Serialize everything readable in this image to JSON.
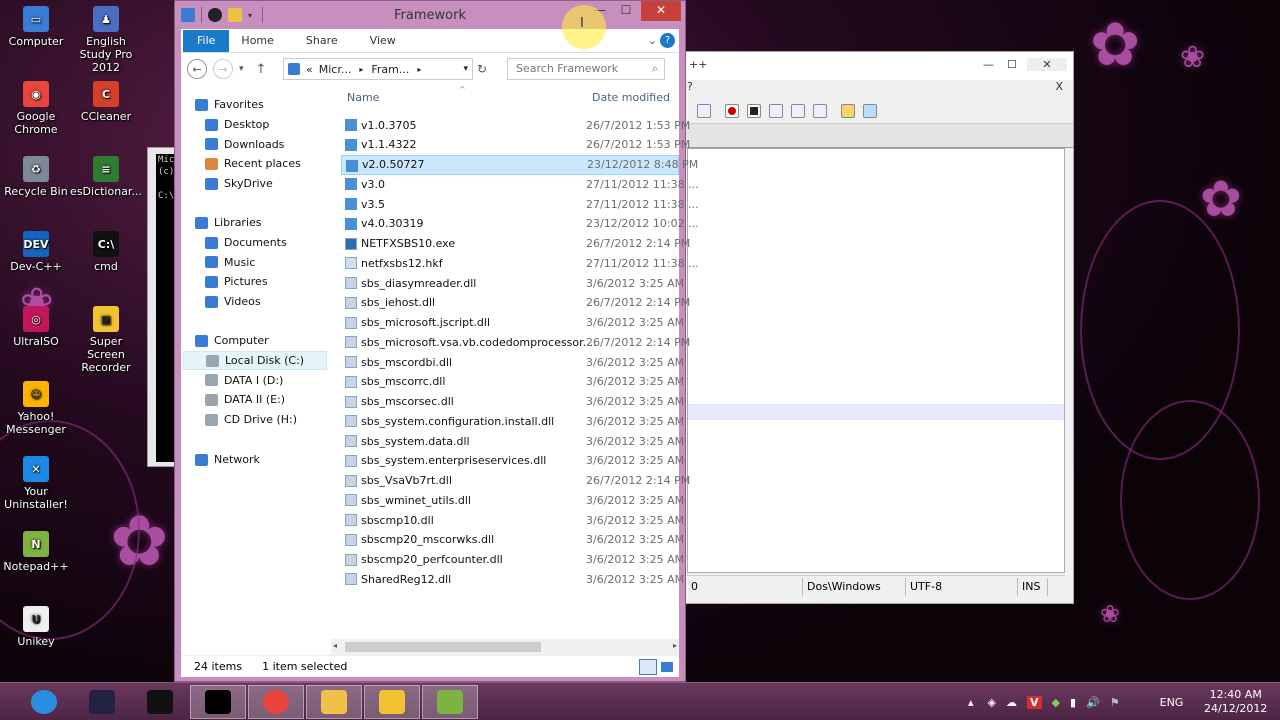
{
  "desktop": {
    "icons": [
      {
        "label": "Computer",
        "color": "#3a7bd5",
        "glyph": "▭"
      },
      {
        "label": "English Study Pro 2012",
        "color": "#4a6fc0",
        "glyph": "♟"
      },
      {
        "label": "Google Chrome",
        "color": "#e8453c",
        "glyph": "◉"
      },
      {
        "label": "CCleaner",
        "color": "#d6402b",
        "glyph": "C"
      },
      {
        "label": "Recycle Bin",
        "color": "#7d8a96",
        "glyph": "♻"
      },
      {
        "label": "esDictionar...",
        "color": "#2e7d32",
        "glyph": "≡"
      },
      {
        "label": "Dev-C++",
        "color": "#1565c0",
        "glyph": "DEV"
      },
      {
        "label": "cmd",
        "color": "#111111",
        "glyph": "C:\\"
      },
      {
        "label": "UltraISO",
        "color": "#c2185b",
        "glyph": "◎"
      },
      {
        "label": "Super Screen Recorder",
        "color": "#f2c230",
        "glyph": "▣"
      },
      {
        "label": "Yahoo! Messenger",
        "color": "#ffb300",
        "glyph": "☺"
      },
      {
        "label": "Your Uninstaller!",
        "color": "#1e88e5",
        "glyph": "✕"
      },
      {
        "label": "Notepad++",
        "color": "#7cb342",
        "glyph": "N"
      },
      {
        "label": "Unikey",
        "color": "#eeeeee",
        "glyph": "U"
      }
    ]
  },
  "cmd_window": {
    "lines": [
      "Mic",
      "(c)",
      "",
      "C:\\"
    ]
  },
  "notepadpp": {
    "title_fragment": "++",
    "menu_fragment": "?",
    "close_doc": "X",
    "status": {
      "col": "0",
      "eol": "Dos\\Windows",
      "encoding": "UTF-8",
      "mode": "INS"
    }
  },
  "explorer": {
    "title": "Framework",
    "ribbon_tabs": [
      "File",
      "Home",
      "Share",
      "View"
    ],
    "breadcrumb": [
      "«",
      "Micr...",
      "▸",
      "Fram...",
      "▸"
    ],
    "search_placeholder": "Search Framework",
    "nav": {
      "favorites_header": "Favorites",
      "favorites": [
        "Desktop",
        "Downloads",
        "Recent places",
        "SkyDrive"
      ],
      "libraries_header": "Libraries",
      "libraries": [
        "Documents",
        "Music",
        "Pictures",
        "Videos"
      ],
      "computer_header": "Computer",
      "drives": [
        "Local Disk (C:)",
        "DATA I (D:)",
        "DATA II (E:)",
        "CD Drive (H:)"
      ],
      "network": "Network"
    },
    "columns": {
      "name": "Name",
      "date": "Date modified"
    },
    "files": [
      {
        "name": "v1.0.3705",
        "date": "26/7/2012 1:53 PM",
        "type": "folder"
      },
      {
        "name": "v1.1.4322",
        "date": "26/7/2012 1:53 PM",
        "type": "folder"
      },
      {
        "name": "v2.0.50727",
        "date": "23/12/2012 8:48 PM",
        "type": "folder",
        "selected": true
      },
      {
        "name": "v3.0",
        "date": "27/11/2012 11:38 ...",
        "type": "folder"
      },
      {
        "name": "v3.5",
        "date": "27/11/2012 11:38 ...",
        "type": "folder"
      },
      {
        "name": "v4.0.30319",
        "date": "23/12/2012 10:02 ...",
        "type": "folder"
      },
      {
        "name": "NETFXSBS10.exe",
        "date": "26/7/2012 2:14 PM",
        "type": "exe"
      },
      {
        "name": "netfxsbs12.hkf",
        "date": "27/11/2012 11:38 ...",
        "type": "file"
      },
      {
        "name": "sbs_diasymreader.dll",
        "date": "3/6/2012 3:25 AM",
        "type": "dll"
      },
      {
        "name": "sbs_iehost.dll",
        "date": "26/7/2012 2:14 PM",
        "type": "dll"
      },
      {
        "name": "sbs_microsoft.jscript.dll",
        "date": "3/6/2012 3:25 AM",
        "type": "dll"
      },
      {
        "name": "sbs_microsoft.vsa.vb.codedomprocessor....",
        "date": "26/7/2012 2:14 PM",
        "type": "dll"
      },
      {
        "name": "sbs_mscordbi.dll",
        "date": "3/6/2012 3:25 AM",
        "type": "dll"
      },
      {
        "name": "sbs_mscorrc.dll",
        "date": "3/6/2012 3:25 AM",
        "type": "dll"
      },
      {
        "name": "sbs_mscorsec.dll",
        "date": "3/6/2012 3:25 AM",
        "type": "dll"
      },
      {
        "name": "sbs_system.configuration.install.dll",
        "date": "3/6/2012 3:25 AM",
        "type": "dll"
      },
      {
        "name": "sbs_system.data.dll",
        "date": "3/6/2012 3:25 AM",
        "type": "dll"
      },
      {
        "name": "sbs_system.enterpriseservices.dll",
        "date": "3/6/2012 3:25 AM",
        "type": "dll"
      },
      {
        "name": "sbs_VsaVb7rt.dll",
        "date": "26/7/2012 2:14 PM",
        "type": "dll"
      },
      {
        "name": "sbs_wminet_utils.dll",
        "date": "3/6/2012 3:25 AM",
        "type": "dll"
      },
      {
        "name": "sbscmp10.dll",
        "date": "3/6/2012 3:25 AM",
        "type": "dll"
      },
      {
        "name": "sbscmp20_mscorwks.dll",
        "date": "3/6/2012 3:25 AM",
        "type": "dll"
      },
      {
        "name": "sbscmp20_perfcounter.dll",
        "date": "3/6/2012 3:25 AM",
        "type": "dll"
      },
      {
        "name": "SharedReg12.dll",
        "date": "3/6/2012 3:25 AM",
        "type": "dll"
      }
    ],
    "status": {
      "count": "24 items",
      "selection": "1 item selected"
    }
  },
  "taskbar": {
    "apps": [
      "ie-icon",
      "media-icon",
      "calculator-icon",
      "cmd-icon",
      "chrome-icon",
      "explorer-icon",
      "recorder-icon",
      "notepadpp-icon"
    ],
    "language": "ENG",
    "time": "12:40 AM",
    "date": "24/12/2012"
  },
  "colors": {
    "folder": "#4a90d9",
    "selection": "#cce8ff",
    "file_tab": "#1979ca",
    "accent": "#c78fbe"
  }
}
